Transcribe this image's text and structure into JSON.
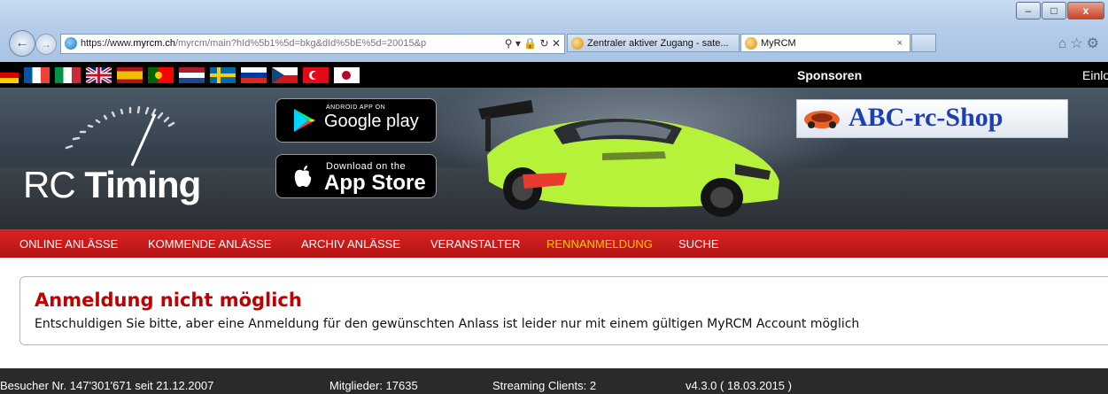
{
  "browser": {
    "url_host": "https://www.",
    "url_domain": "myrcm.ch",
    "url_path": "/myrcm/main?hId%5b1%5d=bkg&dId%5bE%5d=20015&p",
    "tabs": [
      {
        "label": "Zentraler aktiver Zugang - sate..."
      },
      {
        "label": "MyRCM"
      }
    ],
    "tab_close": "×",
    "window_buttons": {
      "minimize": "–",
      "maximize": "□",
      "close": "x"
    }
  },
  "topbar": {
    "flags": [
      "de",
      "fr",
      "it",
      "gb",
      "es",
      "pt",
      "nl",
      "se",
      "ru",
      "cz",
      "tr",
      "jp"
    ],
    "sponsoren": "Sponsoren",
    "login": "Einlo"
  },
  "banner": {
    "logo_light": "RC ",
    "logo_bold": "Timing",
    "google_play_small": "ANDROID APP ON",
    "google_play_big": "Google play",
    "app_store_small": "Download on the",
    "app_store_big": "App Store",
    "sponsor": "ABC-rc-Shop"
  },
  "menu": {
    "items": [
      {
        "label": "ONLINE ANLÄSSE"
      },
      {
        "label": "KOMMENDE ANLÄSSE"
      },
      {
        "label": "ARCHIV ANLÄSSE"
      },
      {
        "label": "VERANSTALTER"
      },
      {
        "label": "RENNANMELDUNG",
        "active": true
      },
      {
        "label": "SUCHE"
      }
    ]
  },
  "message": {
    "title": "Anmeldung nicht möglich",
    "text": "Entschuldigen Sie bitte, aber eine Anmeldung für den gewünschten Anlass ist leider nur mit einem gültigen MyRCM Account möglich"
  },
  "footer": {
    "visitors": "Besucher Nr. 147'301'671 seit 21.12.2007",
    "members": "Mitglieder: 17635",
    "streaming": "Streaming Clients: 2",
    "version": "v4.3.0 ( 18.03.2015 )"
  },
  "colors": {
    "menu_red": "#c81b1b",
    "active_menu": "#f9c900",
    "title_red": "#c00000",
    "footer_bg": "#2a2a2a"
  }
}
